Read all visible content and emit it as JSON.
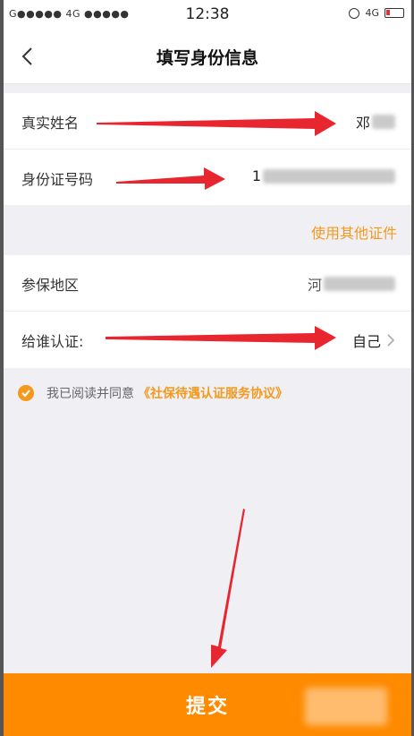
{
  "status_bar": {
    "carrier": "G●●●●● 4G ●●●●●",
    "time": "12:38",
    "network": "4G"
  },
  "nav": {
    "title": "填写身份信息"
  },
  "form": {
    "name": {
      "label": "真实姓名",
      "value_visible": "邓"
    },
    "id_number": {
      "label": "身份证号码",
      "value_visible": "1"
    },
    "alt_id_link": "使用其他证件",
    "region": {
      "label": "参保地区",
      "value_visible": "河"
    },
    "certify_for": {
      "label": "给谁认证:",
      "value": "自己"
    }
  },
  "agreement": {
    "text": "我已阅读并同意",
    "link": "《社保待遇认证服务协议》"
  },
  "submit": {
    "label": "提交"
  },
  "colors": {
    "accent": "#f39a1e",
    "submit_bg": "#fe8a00",
    "arrow": "#e8262f"
  }
}
